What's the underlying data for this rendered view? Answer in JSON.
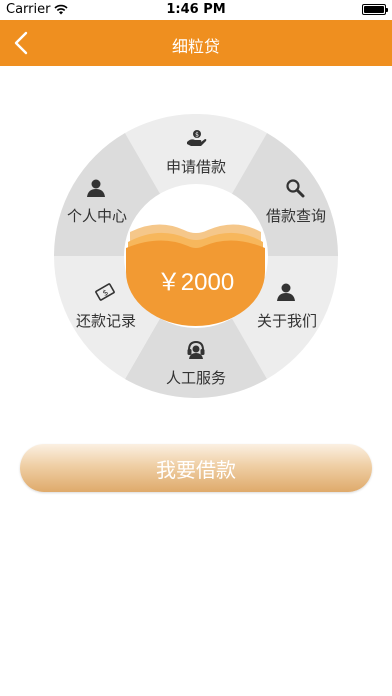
{
  "status_bar": {
    "carrier": "Carrier",
    "time": "1:46 PM"
  },
  "nav": {
    "title": "细粒贷"
  },
  "wheel": {
    "segments": [
      {
        "label": "申请借款",
        "icon": "hand-coin-icon"
      },
      {
        "label": "借款查询",
        "icon": "search-icon"
      },
      {
        "label": "关于我们",
        "icon": "person-icon"
      },
      {
        "label": "人工服务",
        "icon": "headset-icon"
      },
      {
        "label": "还款记录",
        "icon": "receipt-icon"
      },
      {
        "label": "个人中心",
        "icon": "user-icon"
      }
    ],
    "amount": "￥2000"
  },
  "actions": {
    "borrow_label": "我要借款"
  },
  "colors": {
    "accent": "#ef8f1f",
    "wheel_light": "#ededed",
    "wheel_dark": "#dcdcdc",
    "center_orange": "#f29a33"
  }
}
